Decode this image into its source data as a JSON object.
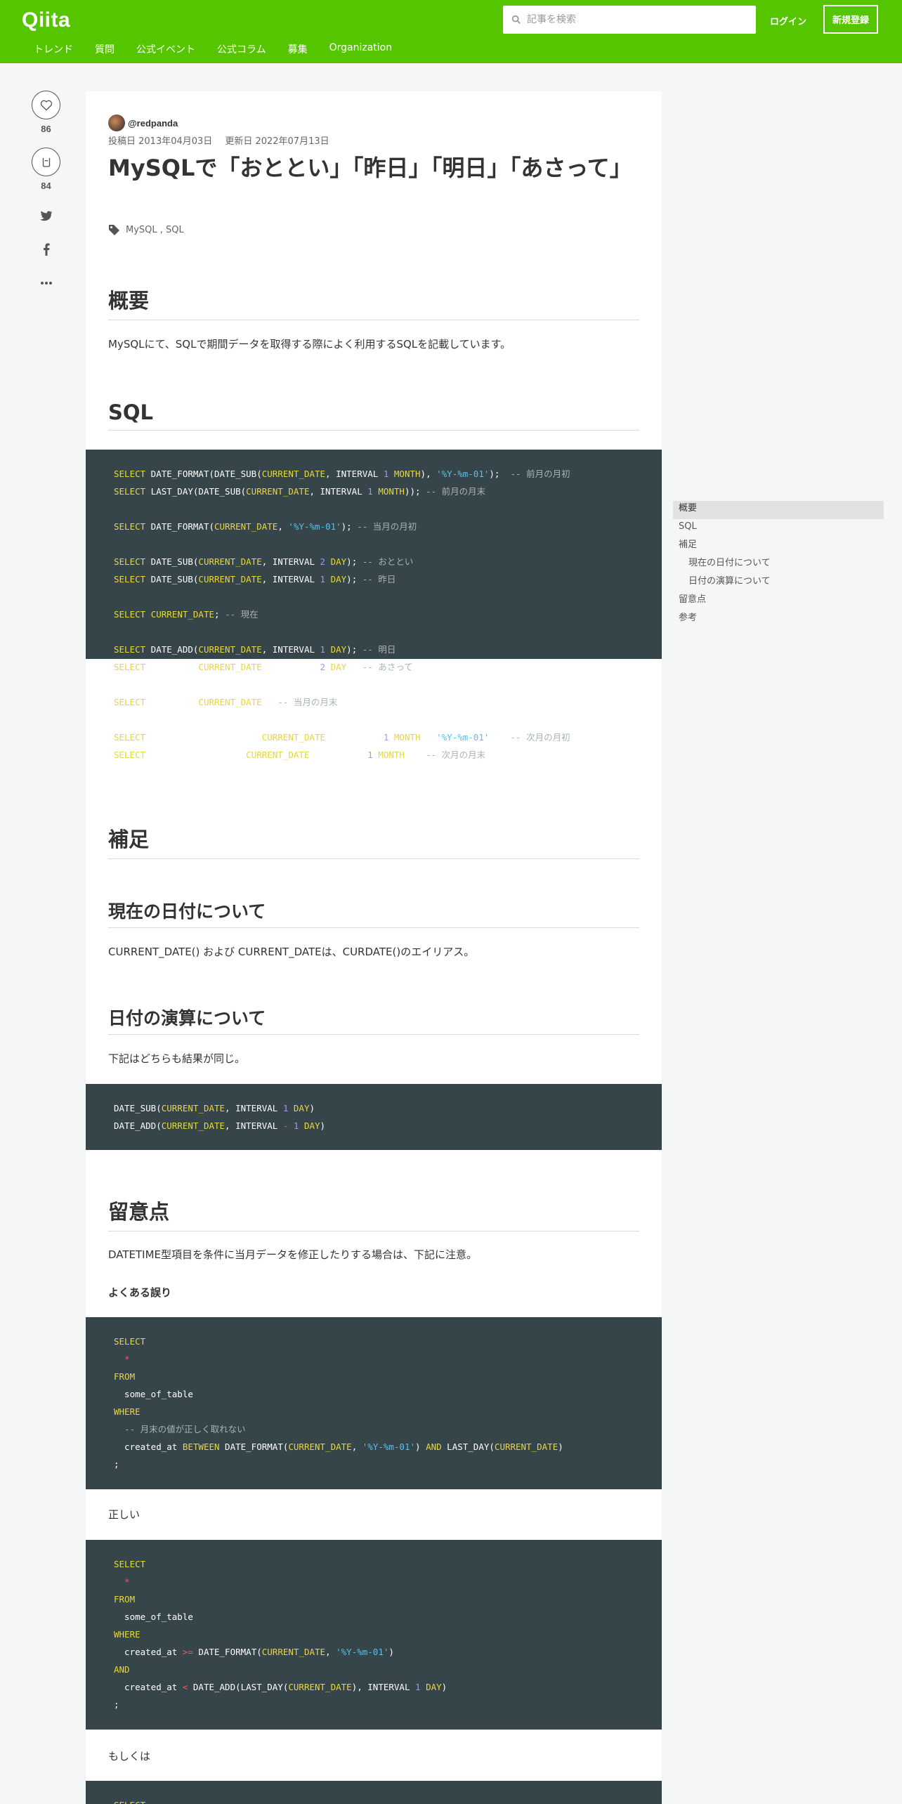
{
  "header": {
    "logo": "Qiita",
    "search_placeholder": "記事を検索",
    "login": "ログイン",
    "signup": "新規登録",
    "nav": [
      "トレンド",
      "質問",
      "公式イベント",
      "公式コラム",
      "募集",
      "Organization"
    ]
  },
  "actions": {
    "likes": "86",
    "stocks": "84"
  },
  "article": {
    "author": "@redpanda",
    "posted": "投稿日 2013年04月03日",
    "updated": "更新日 2022年07月13日",
    "title": "MySQLで「おととい」「昨日」「明日」「あさって」",
    "tags": "MySQL , SQL",
    "h_overview": "概要",
    "overview_text": "MySQLにて、SQLで期間データを取得する際によく利用するSQLを記載しています。",
    "h_sql": "SQL",
    "h_supplement": "補足",
    "h_current_date": "現在の日付について",
    "current_date_text": "CURRENT_DATE() および CURRENT_DATEは、CURDATE()のエイリアス。",
    "h_date_calc": "日付の演算について",
    "date_calc_text": "下記はどちらも結果が同じ。",
    "h_caution": "留意点",
    "caution_text": "DATETIME型項目を条件に当月データを修正したりする場合は、下記に注意。",
    "common_mistake": "よくある誤り",
    "correct": "正しい",
    "or_else": "もしくは"
  },
  "toc": [
    "概要",
    "SQL",
    "補足",
    "現在の日付について",
    "日付の演算について",
    "留意点",
    "参考"
  ],
  "colors": {
    "brand": "#55c500",
    "code_bg": "#364549"
  }
}
